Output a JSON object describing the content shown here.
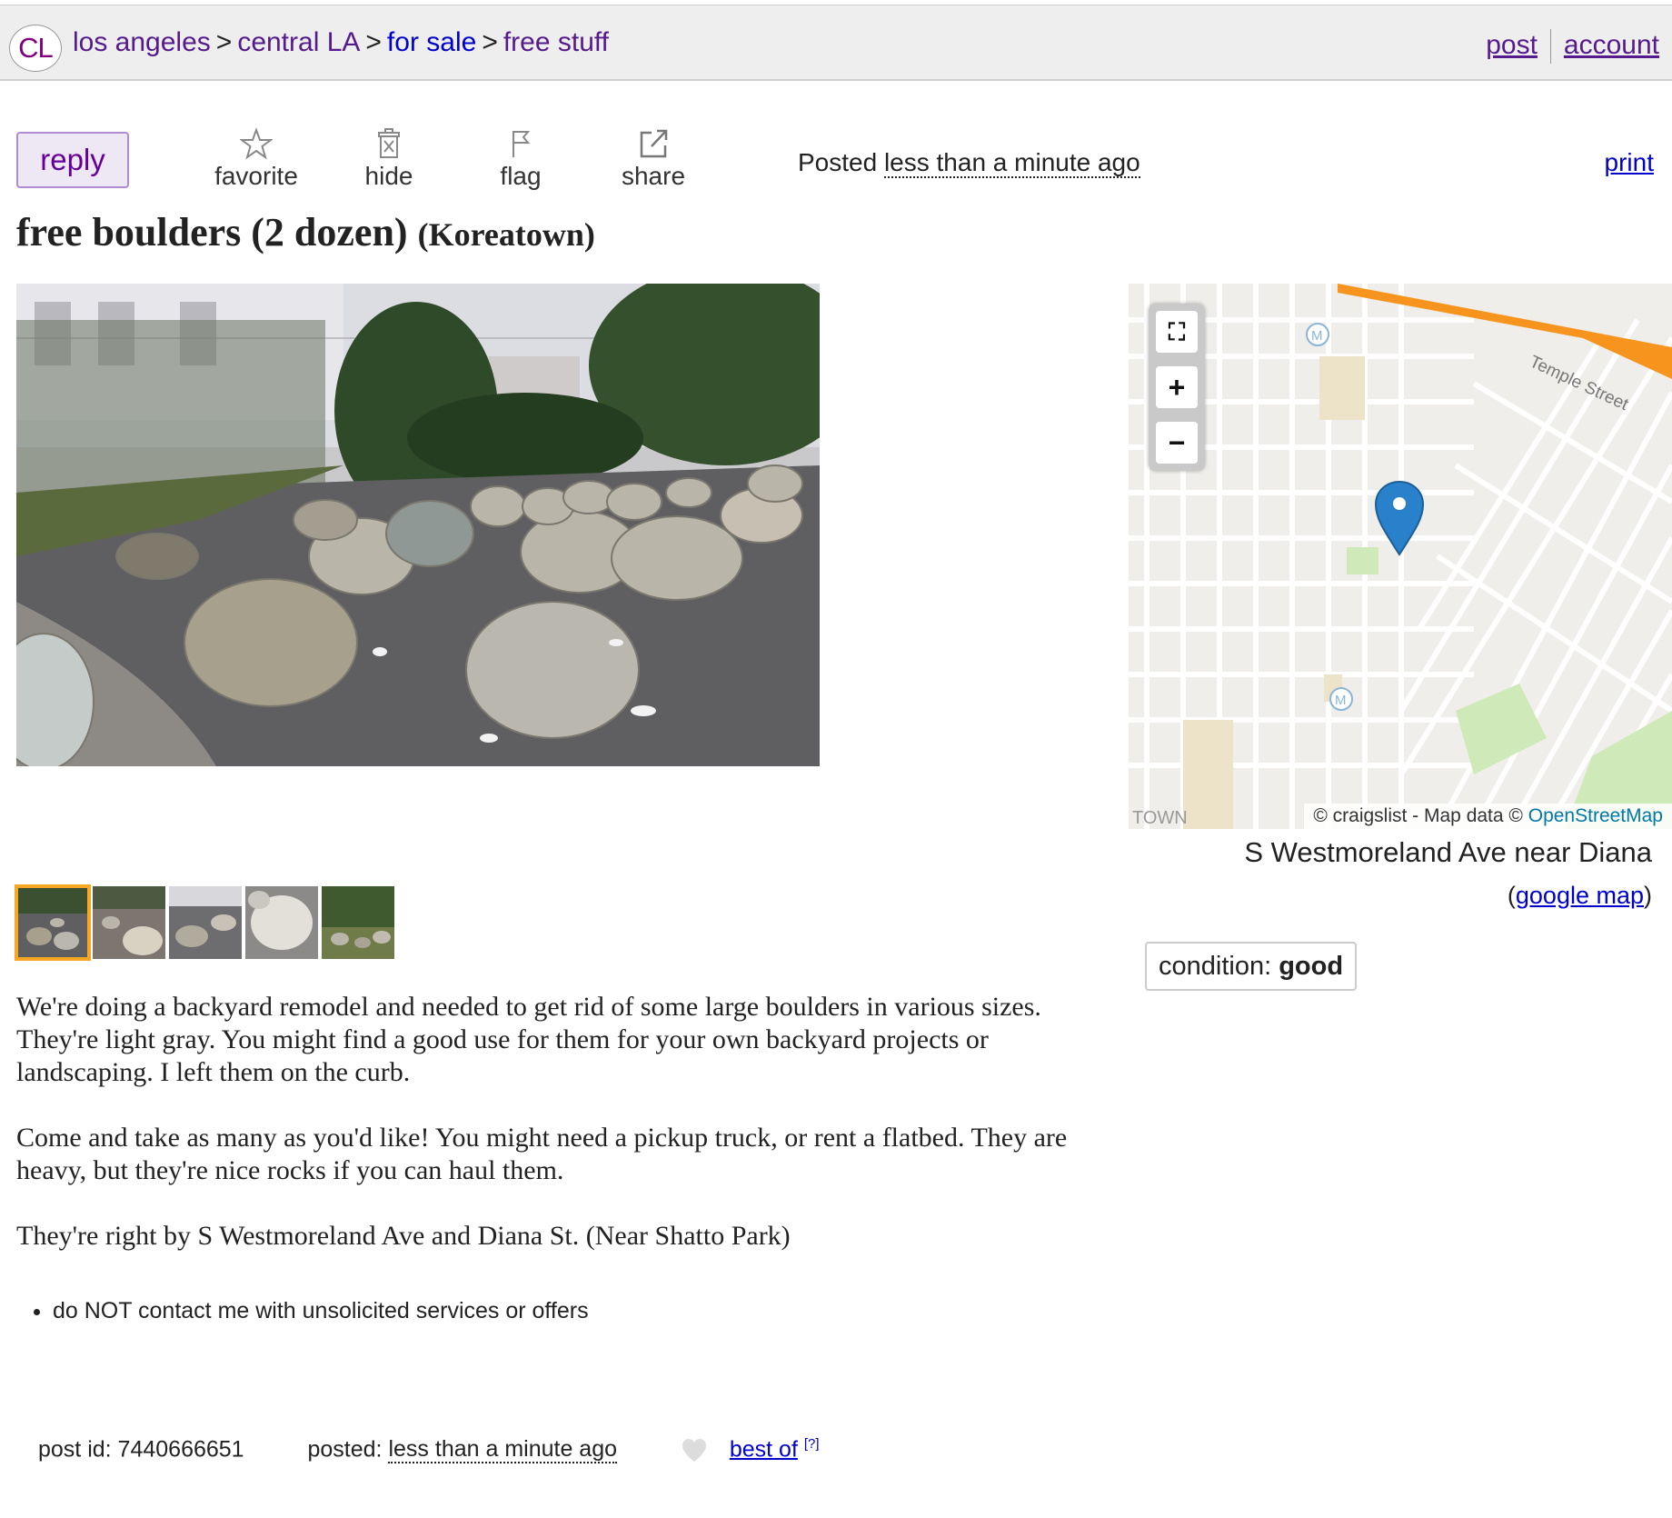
{
  "header": {
    "logo": "CL",
    "breadcrumbs": [
      {
        "label": "los angeles"
      },
      {
        "label": "central LA"
      },
      {
        "label": "for sale"
      },
      {
        "label": "free stuff"
      }
    ],
    "separator": ">",
    "post_link": "post",
    "account_link": "account"
  },
  "actions": {
    "reply": "reply",
    "favorite": "favorite",
    "hide": "hide",
    "flag": "flag",
    "share": "share",
    "posted_prefix": "Posted",
    "posted_time": "less than a minute ago",
    "print": "print"
  },
  "listing": {
    "title": "free boulders (2 dozen)",
    "neighborhood": "(Koreatown)",
    "body": [
      "We're doing a backyard remodel and needed to get rid of some large boulders in various sizes. They're light gray. You might find a good use for them for your own backyard projects or landscaping. I left them on the curb.",
      "Come and take as many as you'd like! You might need a pickup truck, or rent a flatbed. They are heavy, but they're nice rocks if you can haul them.",
      "They're right by S Westmoreland Ave and Diana St. (Near Shatto Park)"
    ],
    "notice": "do NOT contact me with unsolicited services or offers",
    "thumbnail_count": 5
  },
  "map": {
    "street_label": "Temple Street",
    "town_label": "TOWN",
    "attribution_prefix": "© craigslist - Map data ©",
    "attribution_osm": "OpenStreetMap",
    "location": "S Westmoreland Ave near Diana",
    "google_map_open": "(",
    "google_map": "google map",
    "google_map_close": ")"
  },
  "attributes": {
    "condition_label": "condition:",
    "condition_value": "good"
  },
  "footer": {
    "post_id": "post id: 7440666651",
    "posted_label": "posted:",
    "posted_time": "less than a minute ago",
    "best_of": "best of",
    "help": "[?]"
  },
  "colors": {
    "visited_link": "#551a8b",
    "link": "#0000cc",
    "reply_border": "#b18bd0",
    "map_route": "#f7941d",
    "map_pin": "#2a81cb"
  }
}
